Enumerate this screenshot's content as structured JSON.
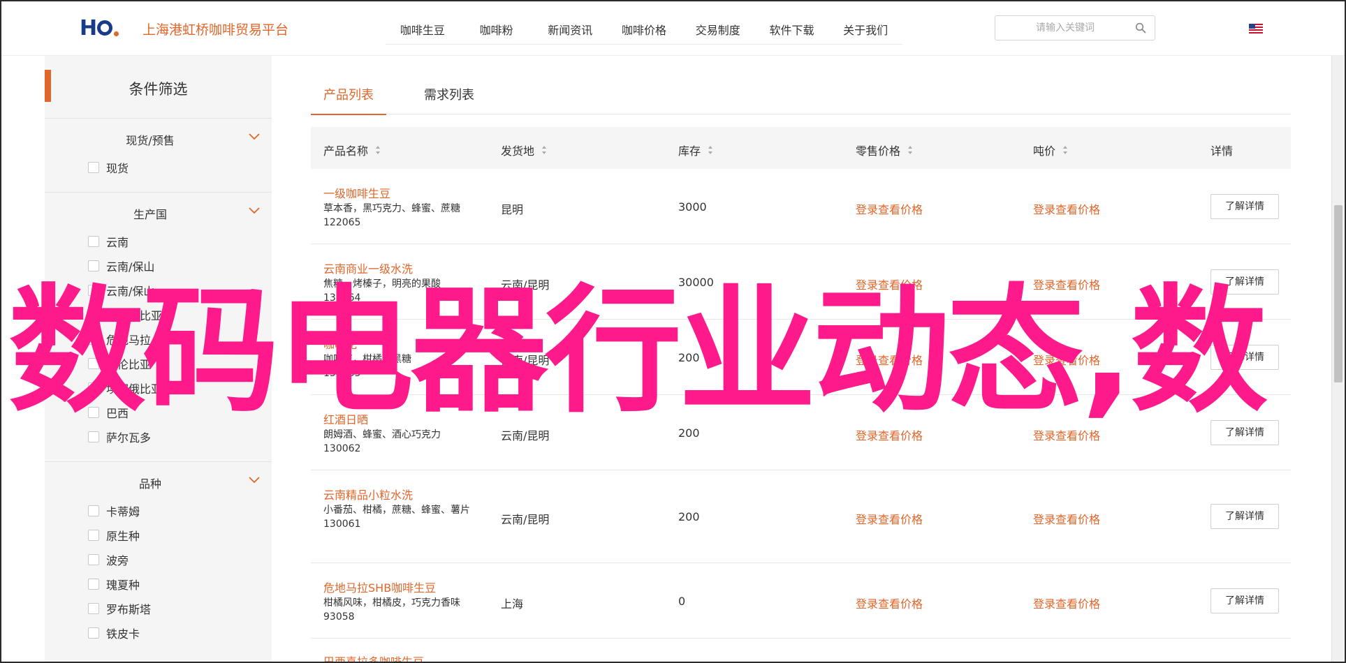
{
  "header": {
    "logo_text": "HO",
    "site_title": "上海港虹桥咖啡贸易平台",
    "nav": [
      "咖啡生豆",
      "咖啡粉",
      "新闻资讯",
      "咖啡价格",
      "交易制度",
      "软件下载",
      "关于我们"
    ],
    "search_placeholder": "请输入关键词",
    "icons": {
      "search": "search-icon",
      "flag": "us-flag-icon"
    }
  },
  "sidebar": {
    "title": "条件筛选",
    "groups": [
      {
        "label": "现货/预售",
        "options": [
          "现货"
        ]
      },
      {
        "label": "生产国",
        "options": [
          "云南",
          "云南/保山",
          "云南/保山",
          "埃塞俄比亚",
          "危地马拉",
          "哥伦比亚",
          "埃塞俄比亚",
          "巴西",
          "萨尔瓦多"
        ]
      },
      {
        "label": "品种",
        "options": [
          "卡蒂姆",
          "原生种",
          "波旁",
          "瑰夏种",
          "罗布斯塔",
          "铁皮卡"
        ]
      }
    ]
  },
  "tabs": [
    "产品列表",
    "需求列表"
  ],
  "table": {
    "headers": [
      "产品名称",
      "发货地",
      "库存",
      "零售价格",
      "吨价",
      "详情"
    ],
    "rows": [
      {
        "name": "一级咖啡生豆",
        "desc": "草本香，黑巧克力、蜂蜜、蔗糖",
        "id": "122065",
        "origin": "昆明",
        "stock": "3000",
        "retail": "登录查看价格",
        "ton": "登录查看价格",
        "detail": "了解详情"
      },
      {
        "name": "云南商业一级水洗",
        "desc": "焦糖，烤榛子，明亮的果酸",
        "id": "130064",
        "origin": "云南/昆明",
        "stock": "30000",
        "retail": "登录查看价格",
        "ton": "登录查看价格",
        "detail": "了解详情"
      },
      {
        "name": "咖啡花",
        "desc": "咖啡花，柑橘，黑糖",
        "id": "130063",
        "origin": "云南/昆明",
        "stock": "200",
        "retail": "登录查看价格",
        "ton": "登录查看价格",
        "detail": "了解详情"
      },
      {
        "name": "红酒日晒",
        "desc": "朗姆酒、蜂蜜、酒心巧克力",
        "id": "130062",
        "origin": "云南/昆明",
        "stock": "200",
        "retail": "登录查看价格",
        "ton": "登录查看价格",
        "detail": "了解详情"
      },
      {
        "name": "云南精品小粒水洗",
        "desc": "小番茄、柑橘，蔗糖、蜂蜜、薯片",
        "id": "130061",
        "origin": "云南/昆明",
        "stock": "200",
        "retail": "登录查看价格",
        "ton": "登录查看价格",
        "detail": "了解详情"
      },
      {
        "name": "危地马拉SHB咖啡生豆",
        "desc": "柑橘风味，柑橘皮，巧克力香味",
        "id": "93058",
        "origin": "上海",
        "stock": "0",
        "retail": "登录查看价格",
        "ton": "登录查看价格",
        "detail": "了解详情"
      },
      {
        "name": "巴西喜拉多咖啡生豆",
        "desc": "",
        "id": "",
        "origin": "",
        "stock": "",
        "retail": "",
        "ton": "",
        "detail": ""
      }
    ]
  },
  "watermark": "数码电器行业动态,数",
  "colors": {
    "accent": "#e0662a",
    "watermark": "#ff1a8c",
    "logo_blue": "#1a3a8a"
  }
}
